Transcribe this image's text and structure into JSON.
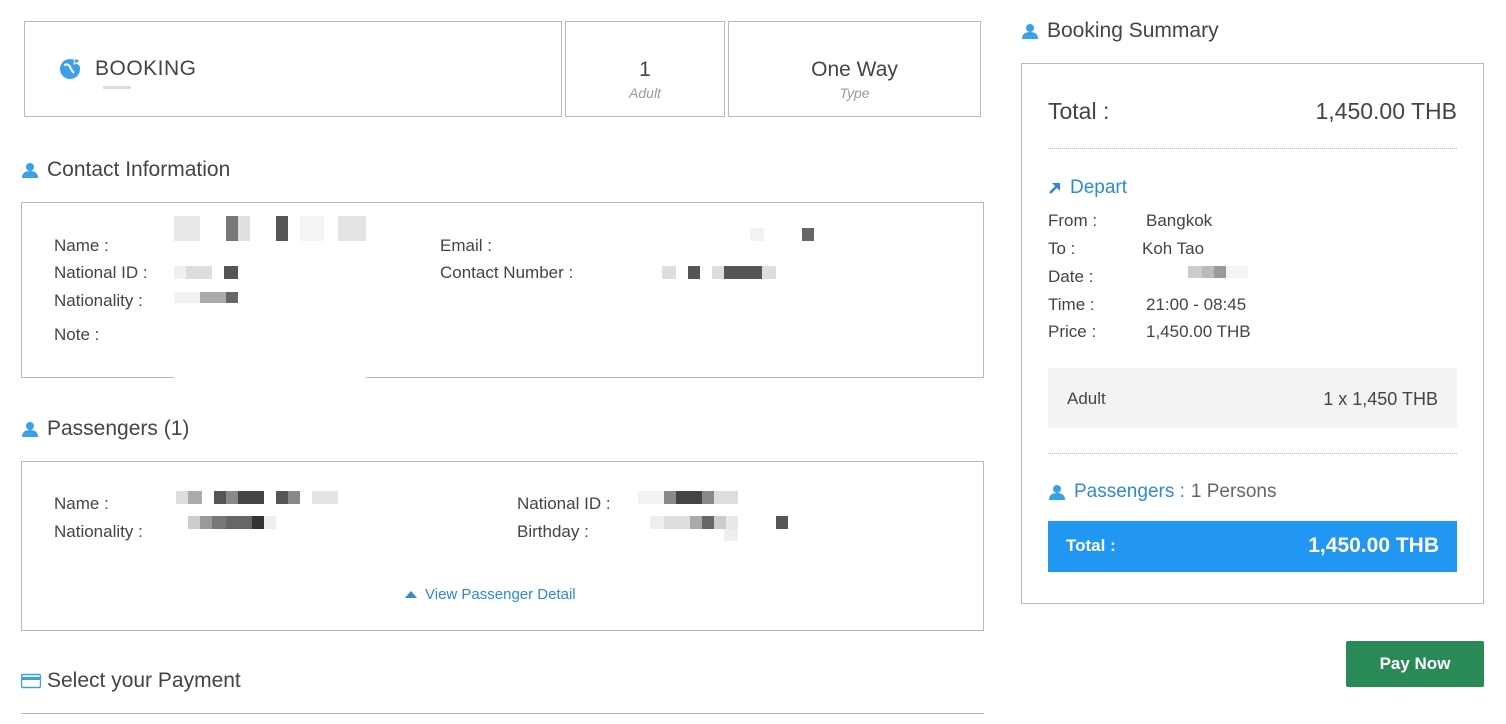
{
  "booking": {
    "title": "BOOKING",
    "adult_count": "1",
    "adult_label": "Adult",
    "trip_type": "One Way",
    "trip_type_label": "Type"
  },
  "contact": {
    "heading": "Contact Information",
    "name_label": "Name :",
    "national_id_label": "National ID :",
    "nationality_label": "Nationality :",
    "note_label": "Note :",
    "email_label": "Email :",
    "contact_number_label": "Contact Number :"
  },
  "passengers": {
    "heading": "Passengers (1)",
    "name_label": "Name :",
    "nationality_label": "Nationality :",
    "national_id_label": "National ID :",
    "birthday_label": "Birthday :",
    "view_detail": "View Passenger Detail"
  },
  "payment": {
    "heading": "Select your Payment"
  },
  "summary": {
    "heading": "Booking Summary",
    "total_label": "Total :",
    "total_value": "1,450.00 THB",
    "depart_label": "Depart",
    "from_label": "From :",
    "from_value": "Bangkok",
    "to_label": "To :",
    "to_value": "Koh Tao",
    "date_label": "Date :",
    "time_label": "Time :",
    "time_value": "21:00 - 08:45",
    "price_label": "Price :",
    "price_value": "1,450.00 THB",
    "fare_label": "Adult",
    "fare_value": "1 x 1,450 THB",
    "passengers_label": "Passengers :",
    "passengers_value": "1 Persons",
    "grand_total_label": "Total :",
    "grand_total_value": "1,450.00 THB"
  },
  "actions": {
    "pay_now": "Pay Now"
  },
  "colors": {
    "accent_blue": "#2196f3",
    "link_blue": "#2e8ad2",
    "pay_green": "#2a8a57",
    "border_gray": "#b9b9b9"
  },
  "icons": {
    "booking": "globe-plane-icon",
    "section": "person-icon",
    "depart": "arrow-up-right-icon",
    "payment": "credit-card-icon",
    "view_detail": "triangle-up-icon"
  }
}
